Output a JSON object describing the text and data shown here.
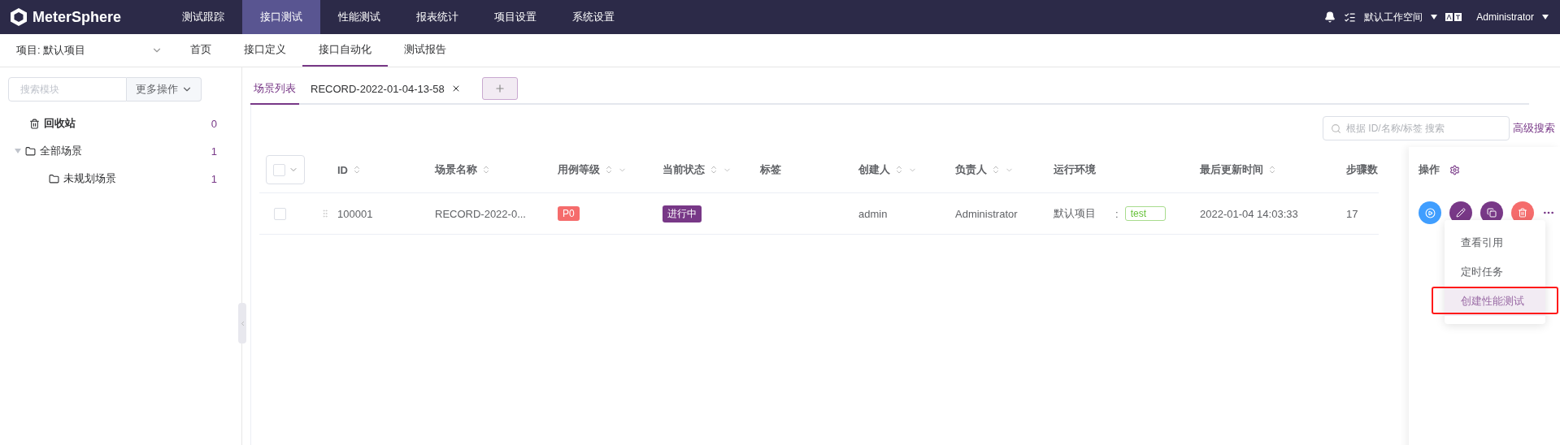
{
  "topbar": {
    "logo": "MeterSphere",
    "menus": [
      {
        "label": "测试跟踪",
        "selected": false
      },
      {
        "label": "接口测试",
        "selected": true
      },
      {
        "label": "性能测试",
        "selected": false
      },
      {
        "label": "报表统计",
        "selected": false
      },
      {
        "label": "项目设置",
        "selected": false
      },
      {
        "label": "系统设置",
        "selected": false
      }
    ],
    "workspace": "默认工作空间",
    "user": "Administrator"
  },
  "subnav": {
    "project": "项目: 默认项目",
    "tabs": [
      {
        "label": "首页",
        "selected": false
      },
      {
        "label": "接口定义",
        "selected": false
      },
      {
        "label": "接口自动化",
        "selected": true
      },
      {
        "label": "测试报告",
        "selected": false
      }
    ]
  },
  "sidebar": {
    "search": {
      "placeholder": "搜索模块"
    },
    "more": "更多操作",
    "tree": [
      {
        "kind": "trash",
        "label": "回收站",
        "count": "0"
      },
      {
        "kind": "folder",
        "label": "全部场景",
        "count": "1",
        "expanded": true,
        "children": [
          {
            "kind": "folder",
            "label": "未规划场景",
            "count": "1"
          }
        ]
      }
    ]
  },
  "tabs": [
    {
      "label": "场景列表",
      "selected": true,
      "closable": false
    },
    {
      "label": "RECORD-2022-01-04-13-58",
      "selected": false,
      "closable": true
    }
  ],
  "toolbar": {
    "search": {
      "placeholder": "根据 ID/名称/标签 搜索"
    },
    "advanced": "高级搜索"
  },
  "table": {
    "columns": [
      {
        "label": "ID",
        "sortable": true,
        "filterable": false
      },
      {
        "label": "场景名称",
        "sortable": true,
        "filterable": false
      },
      {
        "label": "用例等级",
        "sortable": true,
        "filterable": true
      },
      {
        "label": "当前状态",
        "sortable": true,
        "filterable": true
      },
      {
        "label": "标签",
        "sortable": false,
        "filterable": false
      },
      {
        "label": "创建人",
        "sortable": true,
        "filterable": true
      },
      {
        "label": "负责人",
        "sortable": true,
        "filterable": true
      },
      {
        "label": "运行环境",
        "sortable": false,
        "filterable": false
      },
      {
        "label": "最后更新时间",
        "sortable": true,
        "filterable": false
      },
      {
        "label": "步骤数"
      }
    ],
    "ops_label": "操作",
    "rows": [
      {
        "checked": false,
        "id": "100001",
        "name": "RECORD-2022-0...",
        "level": "P0",
        "status": "进行中",
        "creator": "admin",
        "owner": "Administrator",
        "env": "默认项目",
        "env_sep": ":",
        "env_tag": "test",
        "updated": "2022-01-04 14:03:33",
        "steps": "17",
        "actions": [
          {
            "kind": "run"
          },
          {
            "kind": "edit"
          },
          {
            "kind": "copy"
          },
          {
            "kind": "delete"
          },
          {
            "kind": "more"
          }
        ]
      }
    ]
  },
  "menu": {
    "items": [
      {
        "label": "查看引用",
        "selected": false,
        "outlined": false
      },
      {
        "label": "定时任务",
        "selected": false,
        "outlined": false
      },
      {
        "label": "创建性能测试",
        "selected": true,
        "outlined": true
      }
    ]
  }
}
